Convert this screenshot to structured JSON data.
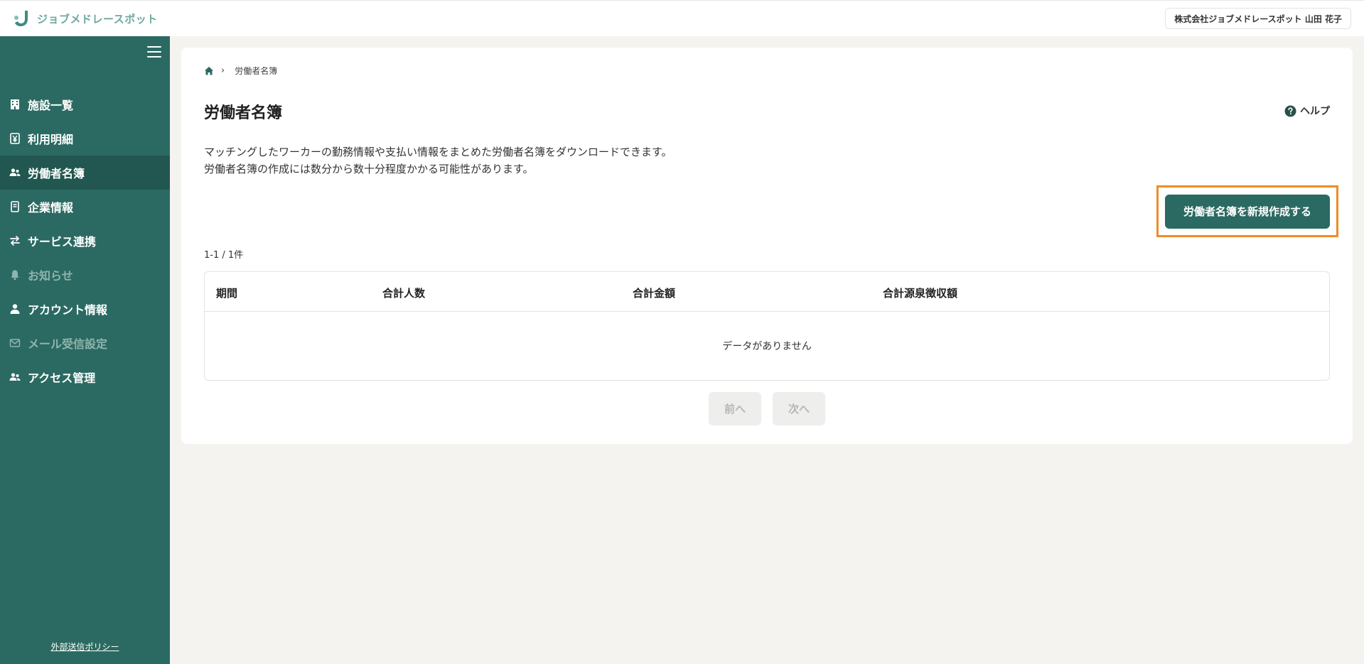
{
  "header": {
    "logo_text": "ジョブメドレースポット",
    "account": "株式会社ジョブメドレースポット 山田 花子"
  },
  "sidebar": {
    "items": [
      {
        "label": "施設一覧",
        "icon": "building-icon",
        "state": "normal"
      },
      {
        "label": "利用明細",
        "icon": "yen-icon",
        "state": "normal"
      },
      {
        "label": "労働者名簿",
        "icon": "users-icon",
        "state": "active"
      },
      {
        "label": "企業情報",
        "icon": "document-icon",
        "state": "normal"
      },
      {
        "label": "サービス連携",
        "icon": "swap-icon",
        "state": "normal"
      },
      {
        "label": "お知らせ",
        "icon": "bell-icon",
        "state": "disabled"
      },
      {
        "label": "アカウント情報",
        "icon": "user-icon",
        "state": "normal"
      },
      {
        "label": "メール受信設定",
        "icon": "mail-icon",
        "state": "disabled"
      },
      {
        "label": "アクセス管理",
        "icon": "users-icon",
        "state": "normal"
      }
    ],
    "footer_link": "外部送信ポリシー"
  },
  "main": {
    "breadcrumb": {
      "current": "労働者名簿"
    },
    "title": "労働者名簿",
    "help_label": "ヘルプ",
    "description": [
      "マッチングしたワーカーの勤務情報や支払い情報をまとめた労働者名簿をダウンロードできます。",
      "労働者名簿の作成には数分から数十分程度かかる可能性があります。"
    ],
    "create_button": "労働者名簿を新規作成する",
    "count": "1-1 / 1件",
    "table": {
      "headers": [
        "期間",
        "合計人数",
        "合計金額",
        "合計源泉徴収額"
      ],
      "empty_message": "データがありません"
    },
    "pager": {
      "prev": "前へ",
      "next": "次へ"
    }
  },
  "colors": {
    "brand": "#2b6a62",
    "brand_active": "#215750",
    "highlight": "#ef8c27"
  }
}
